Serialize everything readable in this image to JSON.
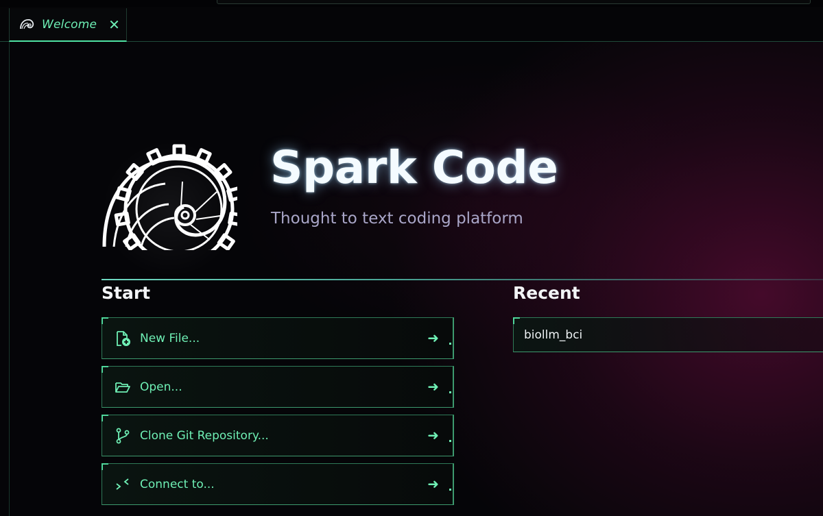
{
  "tabs": [
    {
      "label": "Welcome",
      "icon": "spark-logo-icon",
      "active": true
    }
  ],
  "app": {
    "title": "Spark Code",
    "subtitle": "Thought to text coding platform"
  },
  "start": {
    "title": "Start",
    "actions": [
      {
        "label": "New File...",
        "icon": "new-file-icon"
      },
      {
        "label": "Open...",
        "icon": "folder-open-icon"
      },
      {
        "label": "Clone Git Repository...",
        "icon": "git-branch-icon"
      },
      {
        "label": "Connect to...",
        "icon": "remote-connect-icon"
      }
    ],
    "arrow": "➜"
  },
  "recent": {
    "title": "Recent",
    "items": [
      {
        "label": "biollm_bci"
      }
    ]
  },
  "colors": {
    "accent": "#6ff0b5",
    "border": "#2f7a58",
    "title_glow": "#f4fbff",
    "subtitle": "#a9a6c8"
  }
}
